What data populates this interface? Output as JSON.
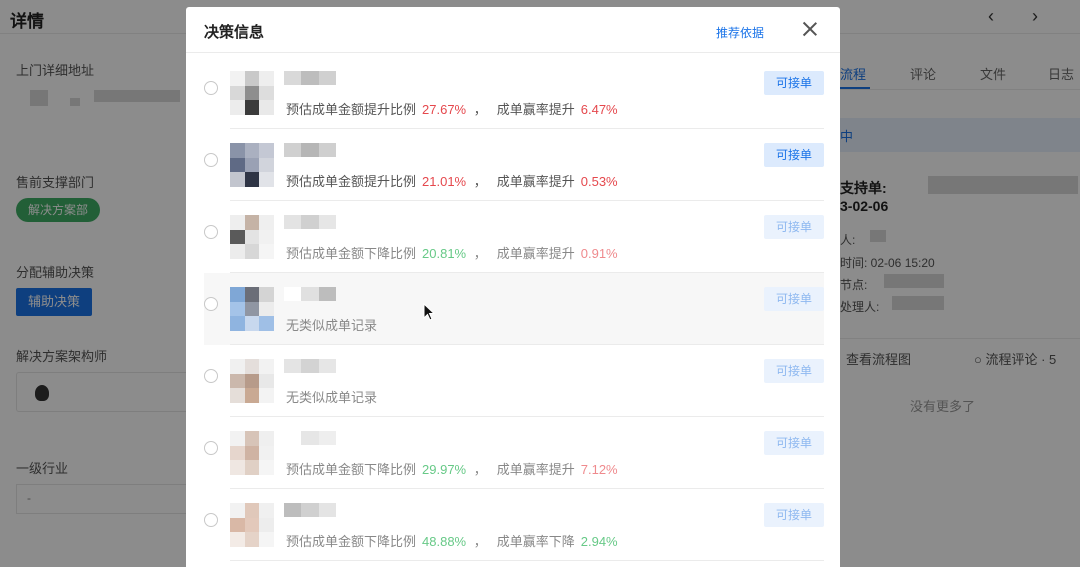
{
  "page": {
    "title": "详情",
    "nav_prev": "‹",
    "nav_next": "›"
  },
  "left_panel": {
    "address_label": "上门详细地址",
    "presales_dept_label": "售前支撑部门",
    "presales_dept_tag": "解决方案部",
    "assist_label": "分配辅助决策",
    "assist_button": "辅助决策",
    "architect_label": "解决方案架构师",
    "architect_name": "",
    "industry_label": "一级行业",
    "industry_value": "-"
  },
  "right_panel": {
    "tabs": [
      {
        "label": "流程"
      },
      {
        "label": "评论"
      },
      {
        "label": "文件"
      },
      {
        "label": "日志"
      }
    ],
    "status_text": "中",
    "order_label": "支持单:",
    "order_date": "3-02-06",
    "person_label": "人:",
    "time_label": "时间: 02-06 15:20",
    "node_label": "节点:",
    "handler_label": "处理人:",
    "view_flow_link": "查看流程图",
    "flow_comment_link": "流程评论 · 5",
    "empty_text": "没有更多了"
  },
  "modal": {
    "title": "决策信息",
    "basis_link": "推荐依据",
    "items": [
      {
        "metric_label": "预估成单金额提升比例",
        "metric_value": "27.67%",
        "metric_color": "red",
        "rate_label": "成单赢率提升",
        "rate_value": "6.47%",
        "rate_color": "red",
        "no_record": "",
        "button": "可接单",
        "disabled": false
      },
      {
        "metric_label": "预估成单金额提升比例",
        "metric_value": "21.01%",
        "metric_color": "red",
        "rate_label": "成单赢率提升",
        "rate_value": "0.53%",
        "rate_color": "red",
        "no_record": "",
        "button": "可接单",
        "disabled": false
      },
      {
        "metric_label": "预估成单金额下降比例",
        "metric_value": "20.81%",
        "metric_color": "green",
        "rate_label": "成单赢率提升",
        "rate_value": "0.91%",
        "rate_color": "red",
        "no_record": "",
        "button": "可接单",
        "disabled": true
      },
      {
        "metric_label": "",
        "metric_value": "",
        "metric_color": "",
        "rate_label": "",
        "rate_value": "",
        "rate_color": "",
        "no_record": "无类似成单记录",
        "button": "可接单",
        "disabled": true
      },
      {
        "metric_label": "",
        "metric_value": "",
        "metric_color": "",
        "rate_label": "",
        "rate_value": "",
        "rate_color": "",
        "no_record": "无类似成单记录",
        "button": "可接单",
        "disabled": true
      },
      {
        "metric_label": "预估成单金额下降比例",
        "metric_value": "29.97%",
        "metric_color": "green",
        "rate_label": "成单赢率提升",
        "rate_value": "7.12%",
        "rate_color": "red",
        "no_record": "",
        "button": "可接单",
        "disabled": true
      },
      {
        "metric_label": "预估成单金额下降比例",
        "metric_value": "48.88%",
        "metric_color": "green",
        "rate_label": "成单赢率下降",
        "rate_value": "2.94%",
        "rate_color": "green",
        "no_record": "",
        "button": "可接单",
        "disabled": true
      }
    ]
  }
}
